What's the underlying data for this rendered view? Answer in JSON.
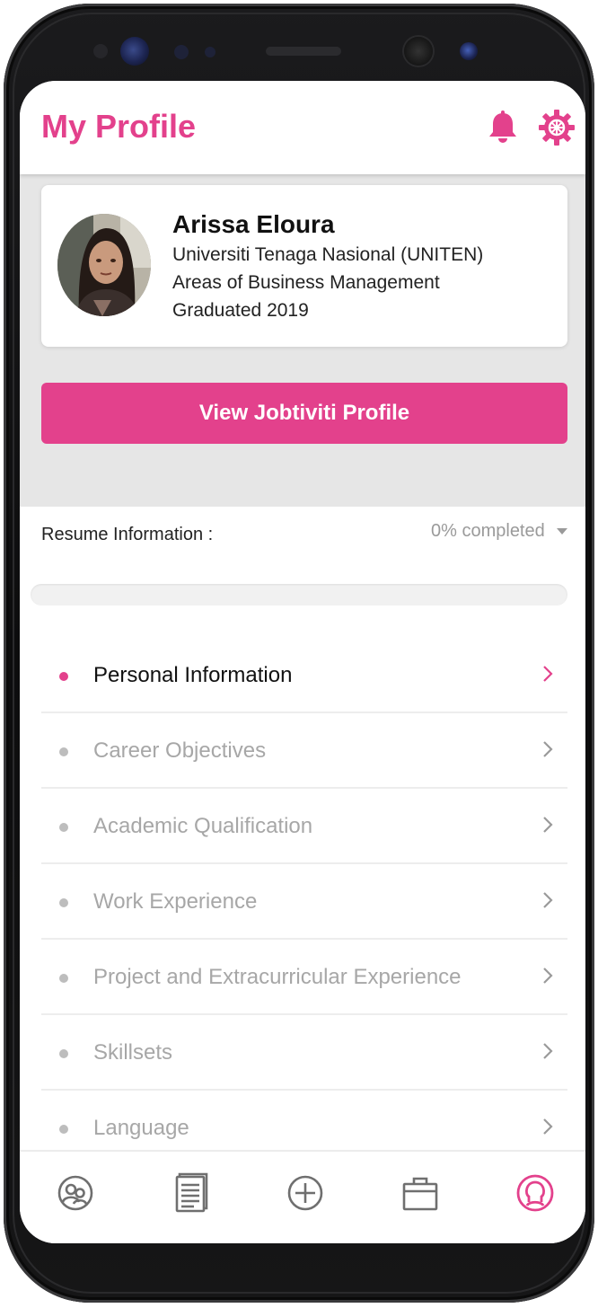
{
  "header": {
    "title": "My Profile",
    "icons": [
      "bell-icon",
      "gear-icon"
    ]
  },
  "profile": {
    "name": "Arissa Eloura",
    "university": "Universiti Tenaga Nasional (UNITEN)",
    "field": "Areas of Business Management",
    "graduated": "Graduated 2019"
  },
  "view_profile_button": "View Jobtiviti Profile",
  "resume": {
    "label": "Resume Information :",
    "completion_text": "0% completed",
    "completion_percent": 0
  },
  "sections": [
    {
      "label": "Personal Information",
      "active": true
    },
    {
      "label": "Career Objectives",
      "active": false
    },
    {
      "label": "Academic Qualification",
      "active": false
    },
    {
      "label": "Work Experience",
      "active": false
    },
    {
      "label": "Project and Extracurricular Experience",
      "active": false
    },
    {
      "label": "Skillsets",
      "active": false
    },
    {
      "label": "Language",
      "active": false
    }
  ],
  "bottom_nav": [
    {
      "icon": "community-icon",
      "active": false
    },
    {
      "icon": "resume-icon",
      "active": false
    },
    {
      "icon": "add-icon",
      "active": false
    },
    {
      "icon": "briefcase-icon",
      "active": false
    },
    {
      "icon": "profile-icon",
      "active": true
    }
  ],
  "colors": {
    "accent": "#e3418c",
    "inactive_text": "#a7a7a7",
    "background_gray": "#e6e6e6"
  }
}
